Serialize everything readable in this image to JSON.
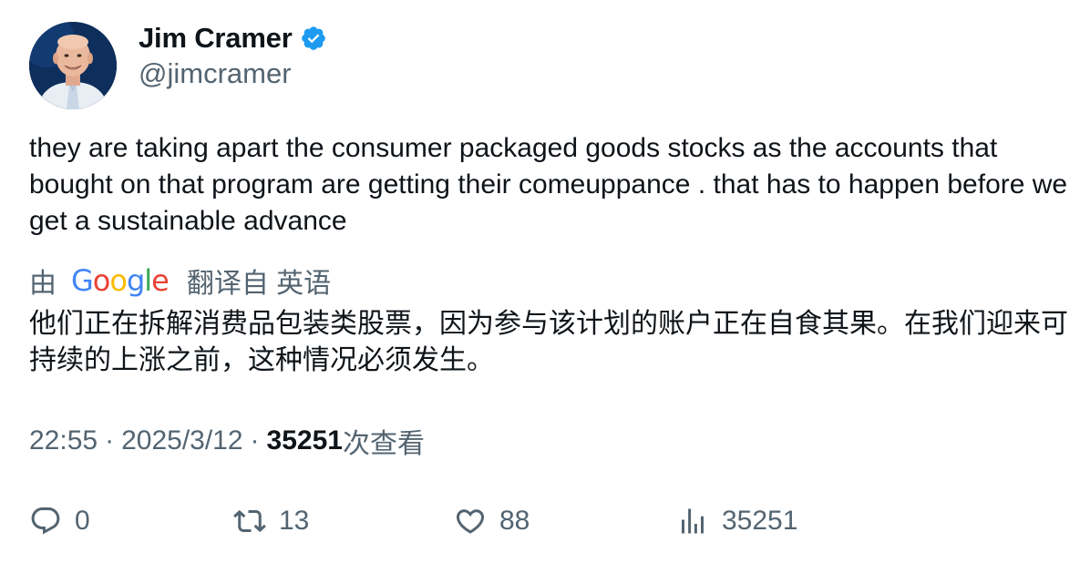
{
  "author": {
    "display_name": "Jim Cramer",
    "handle": "@jimcramer",
    "verified": true,
    "verified_color": "#1d9bf0"
  },
  "tweet": {
    "text": "they are taking apart the consumer packaged goods stocks as the accounts that bought on that program are getting their comeuppance . that has to happen before we get a sustainable advance"
  },
  "translation": {
    "by_label": "由",
    "provider": "Google",
    "from_label": "翻译自 英语",
    "text": "他们正在拆解消费品包装类股票，因为参与该计划的账户正在自食其果。在我们迎来可持续的上涨之前，这种情况必须发生。"
  },
  "meta": {
    "time": "22:55",
    "separator": "·",
    "date": "2025/3/12",
    "views_count": "35251",
    "views_label": "次查看"
  },
  "actions": {
    "reply": {
      "icon": "reply-icon",
      "count": "0"
    },
    "retweet": {
      "icon": "retweet-icon",
      "count": "13"
    },
    "like": {
      "icon": "heart-icon",
      "count": "88"
    },
    "views": {
      "icon": "analytics-icon",
      "count": "35251"
    }
  },
  "colors": {
    "text_primary": "#0f1419",
    "text_secondary": "#536471"
  }
}
